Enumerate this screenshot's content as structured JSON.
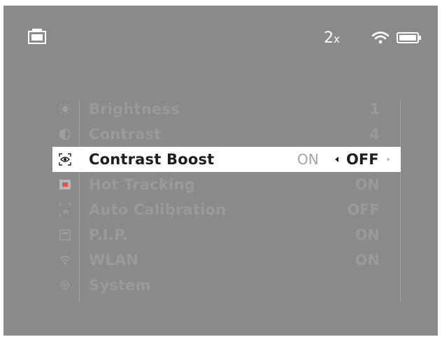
{
  "status": {
    "zoom_value": "2",
    "zoom_unit": "x",
    "icons": [
      "camera-icon",
      "wifi-icon",
      "battery-icon"
    ]
  },
  "menu": {
    "items": [
      {
        "label": "Brightness",
        "value": "1",
        "icon": "sun-icon"
      },
      {
        "label": "Contrast",
        "value": "4",
        "icon": "contrast-icon"
      },
      {
        "label": "Contrast Boost",
        "selected": true,
        "icon": "eye-icon",
        "options": [
          "ON",
          "OFF"
        ],
        "current": "OFF"
      },
      {
        "label": "Hot Tracking",
        "value": "ON",
        "icon": "hot-tracking-icon"
      },
      {
        "label": "Auto Calibration",
        "value": "OFF",
        "icon": "calibration-icon"
      },
      {
        "label": "P.I.P.",
        "value": "ON",
        "icon": "pip-icon"
      },
      {
        "label": "WLAN",
        "value": "ON",
        "icon": "wlan-icon"
      },
      {
        "label": "System",
        "value": "",
        "icon": "gear-icon"
      }
    ]
  },
  "colors": {
    "screen_bg": "#8a8a8a",
    "dim_text": "#9a9a9a",
    "selected_bg": "#ffffff",
    "selected_text": "#1e1e1e",
    "hot_tracking": "#d9534f"
  }
}
